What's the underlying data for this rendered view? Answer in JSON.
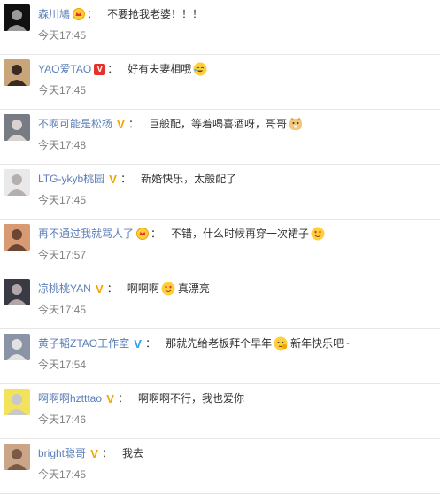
{
  "comments": [
    {
      "user": "森川鳩",
      "badge": "crown",
      "text": "不要抢我老婆！！！",
      "time": "今天17:45",
      "emoji": null,
      "text2": null,
      "avatar_colors": [
        "#111111",
        "#9a9a9a"
      ]
    },
    {
      "user": "YAO爱TAO",
      "badge": "v-red",
      "text": "好有夫妻相哦",
      "time": "今天17:45",
      "emoji": "laughing-tears-icon",
      "text2": null,
      "avatar_colors": [
        "#c9a57a",
        "#3a2a22"
      ]
    },
    {
      "user": "不啊可能是松杨",
      "badge": "v-yellow",
      "text": "巨般配，等着喝喜酒呀，哥哥",
      "time": "今天17:48",
      "emoji": "doge-icon",
      "text2": null,
      "avatar_colors": [
        "#777b83",
        "#d8d2d0"
      ]
    },
    {
      "user": "LTG-ykyb桃园",
      "badge": "v-yellow",
      "text": "新婚快乐，太般配了",
      "time": "今天17:45",
      "emoji": null,
      "text2": null,
      "avatar_colors": [
        "#e9e9ec",
        "#b5b0ae"
      ]
    },
    {
      "user": "再不通过我就骂人了",
      "badge": "crown",
      "text": "不错，什么时候再穿一次裙子",
      "time": "今天17:57",
      "emoji": "heart-eyes-icon",
      "text2": null,
      "avatar_colors": [
        "#d79a72",
        "#6b4634"
      ]
    },
    {
      "user": "凉桃桃YAN",
      "badge": "v-yellow",
      "text": "啊啊啊",
      "time": "今天17:45",
      "emoji": "heart-eyes-icon",
      "text2": "真漂亮",
      "avatar_colors": [
        "#3a3a44",
        "#b2a6a9"
      ]
    },
    {
      "user": "黄子韬ZTAO工作室",
      "badge": "v-blue",
      "text": "那就先给老板拜个早年",
      "time": "今天17:54",
      "emoji": "salute-icon",
      "text2": "新年快乐吧~",
      "avatar_colors": [
        "#8a94a6",
        "#e2e2e2"
      ]
    },
    {
      "user": "啊啊啊hztttao",
      "badge": "v-yellow",
      "text": "啊啊啊不行，我也爱你",
      "time": "今天17:46",
      "emoji": null,
      "text2": null,
      "avatar_colors": [
        "#f3e35c",
        "#c8c8c8"
      ]
    },
    {
      "user": "bright聪哥",
      "badge": "v-yellow",
      "text": "我去",
      "time": "今天17:45",
      "emoji": null,
      "text2": null,
      "avatar_colors": [
        "#cba587",
        "#7a5a44"
      ]
    }
  ],
  "badge_glyphs": {
    "v-yellow": "V",
    "v-red": "V",
    "v-blue": "V",
    "crown": ""
  },
  "colon": "：",
  "colors": {
    "username": "#5b7eb6",
    "time": "#808080",
    "divider": "#e6e6e6",
    "v_yellow": "#f6a300",
    "v_red": "#e7302a",
    "v_blue": "#2a9fe8"
  }
}
